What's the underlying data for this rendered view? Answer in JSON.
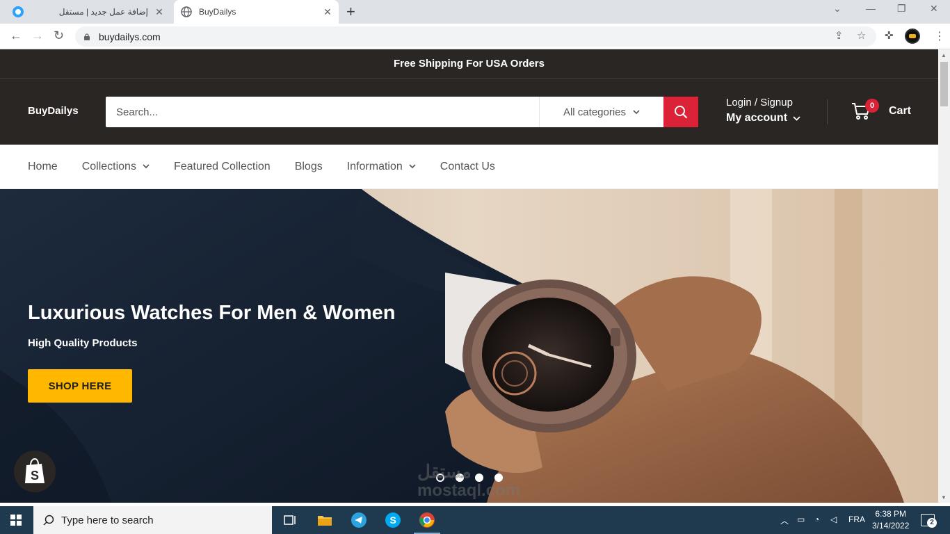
{
  "browser": {
    "tabs": [
      {
        "title": "إضافة عمل جديد | مستقل",
        "active": false
      },
      {
        "title": "BuyDailys",
        "active": true
      }
    ],
    "url": "buydailys.com"
  },
  "site": {
    "announcement": "Free Shipping For USA Orders",
    "logo": "BuyDailys",
    "search": {
      "placeholder": "Search...",
      "category": "All categories"
    },
    "account": {
      "login": "Login / Signup",
      "my_account": "My account"
    },
    "cart": {
      "count": "0",
      "label": "Cart"
    },
    "nav": [
      {
        "label": "Home",
        "dropdown": false
      },
      {
        "label": "Collections",
        "dropdown": true
      },
      {
        "label": "Featured Collection",
        "dropdown": false
      },
      {
        "label": "Blogs",
        "dropdown": false
      },
      {
        "label": "Information",
        "dropdown": true
      },
      {
        "label": "Contact Us",
        "dropdown": false
      }
    ],
    "hero": {
      "title": "Luxurious Watches For Men & Women",
      "subtitle": "High Quality Products",
      "cta": "SHOP HERE",
      "slide_count": 4,
      "active_slide": 1
    },
    "watermark": {
      "line1": "مستقل",
      "line2": "mostaql.com"
    }
  },
  "taskbar": {
    "search_placeholder": "Type here to search",
    "language": "FRA",
    "time": "6:38 PM",
    "date": "3/14/2022",
    "notifications": "2"
  },
  "colors": {
    "header_bg": "#2a2624",
    "accent_red": "#dc2237",
    "cta_yellow": "#ffb700",
    "taskbar_bg": "#1f3a4f"
  }
}
